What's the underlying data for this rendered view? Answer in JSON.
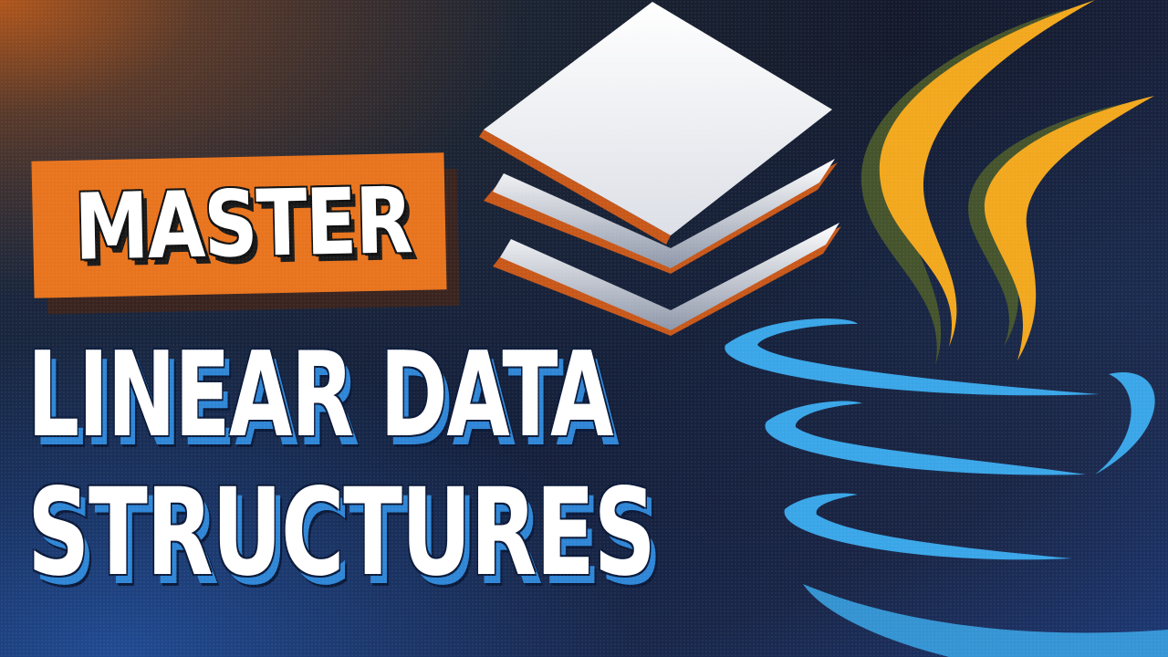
{
  "headline": {
    "badge_text": "MASTER",
    "line1": "LINEAR DATA",
    "line2": "STRUCTURES"
  },
  "icons": {
    "layers": "stacked-layers-icon",
    "language_logo": "coffee-cup-logo"
  },
  "colors": {
    "badge_orange": "#e8741e",
    "text_white": "#ffffff",
    "shadow_blue": "#2f86d6",
    "flame_orange": "#f5a623",
    "cup_blue": "#3aa6e8",
    "background_dark": "#141a2c"
  }
}
